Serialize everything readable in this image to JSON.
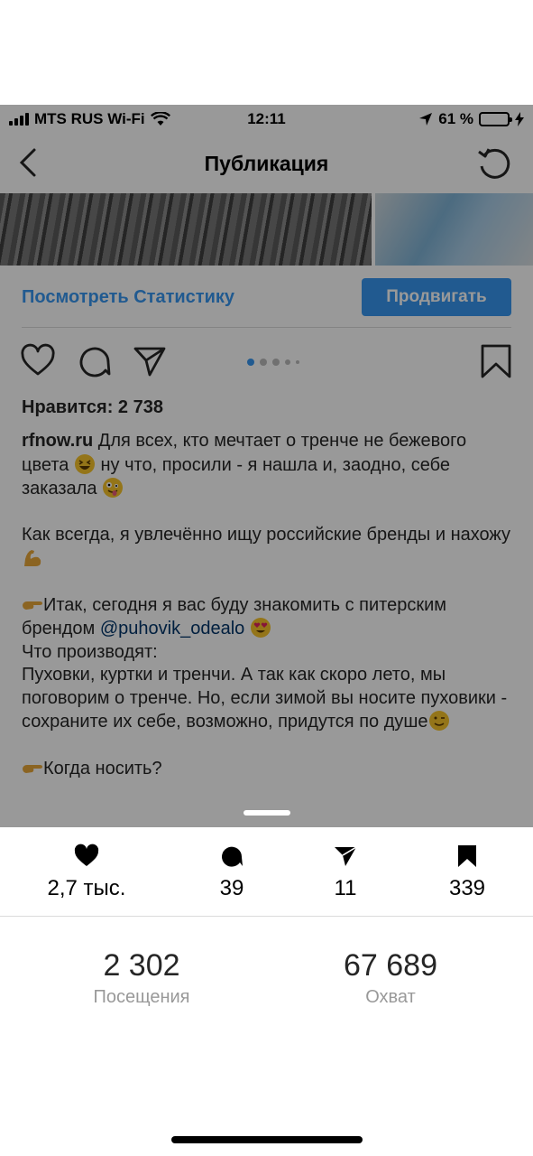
{
  "status_bar": {
    "carrier": "MTS RUS Wi-Fi",
    "time": "12:11",
    "battery": "61 %",
    "battery_level": 0.61
  },
  "nav": {
    "title": "Публикация"
  },
  "actions": {
    "stats_link": "Посмотреть Статистику",
    "promote_button": "Продвигать"
  },
  "post": {
    "likes": "Нравится: 2 738",
    "caption": {
      "username": "rfnow.ru",
      "line1": " Для всех, кто мечтает о тренче не бежевого цвета ",
      "line1b": " ну что, просили - я нашла и, заодно, себе заказала ",
      "p2": "Как всегда, я увлечённо ищу российские бренды и нахожу ",
      "p3a": "Итак, сегодня я вас буду знакомить с питерским брендом ",
      "mention": "@puhovik_odealo",
      "p3b": "Что производят:",
      "p4": "Пуховки, куртки и тренчи. А так как скоро лето, мы поговорим о тренче. Но, если зимой вы носите пуховики - сохраните их себе, возможно, придутся по душе",
      "p5": "Когда носить?"
    },
    "carousel_pages": 5,
    "carousel_active": 1
  },
  "sheet": {
    "likes": "2,7 тыс.",
    "comments": "39",
    "shares": "11",
    "saves": "339",
    "visits_value": "2 302",
    "visits_label": "Посещения",
    "reach_value": "67 689",
    "reach_label": "Охват"
  },
  "colors": {
    "accent": "#3897f0",
    "overlay": "rgba(0,0,0,0.40)"
  }
}
